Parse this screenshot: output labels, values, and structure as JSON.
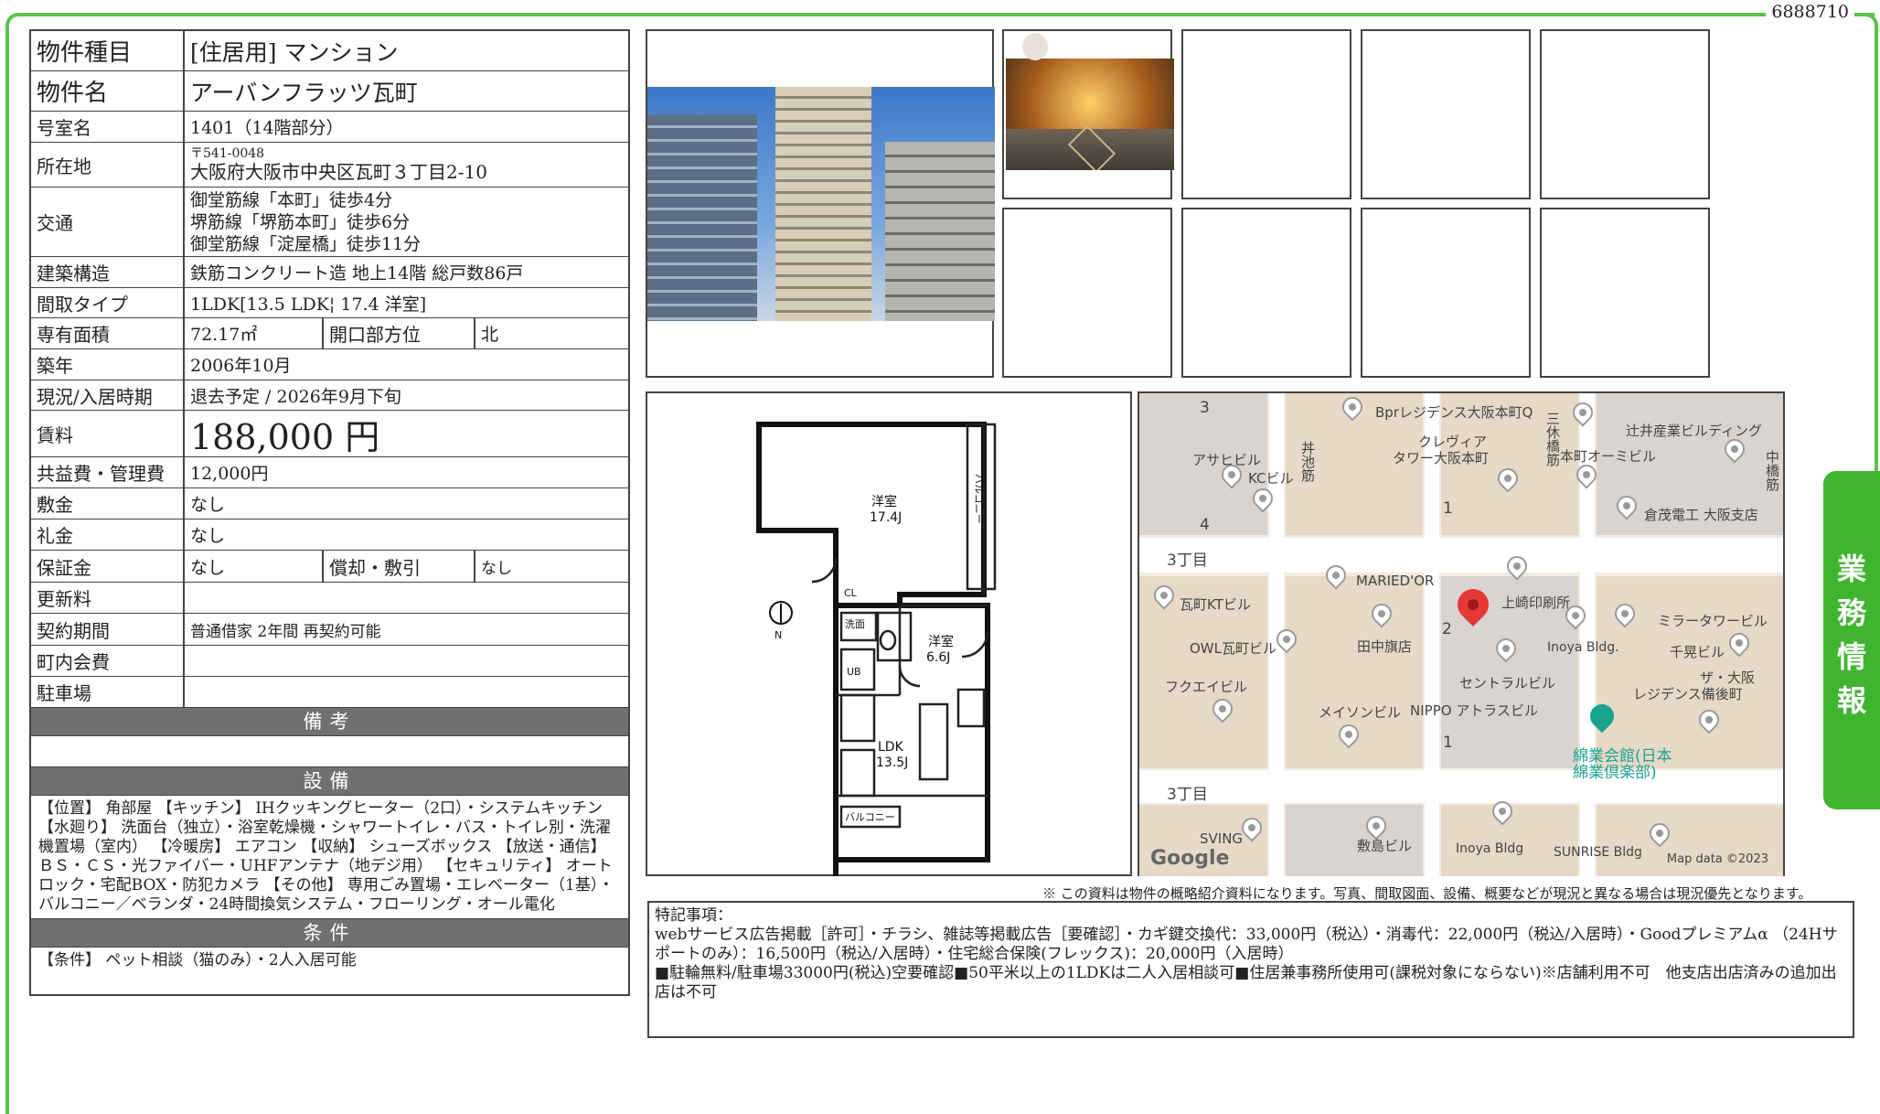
{
  "doc_id": "6888710",
  "spec": {
    "type_label": "物件種目",
    "type_value": "[住居用] マンション",
    "name_label": "物件名",
    "name_value": "アーバンフラッツ瓦町",
    "room_label": "号室名",
    "room_value": "1401（14階部分）",
    "addr_label": "所在地",
    "addr_zip": "〒541-0048",
    "addr_value": "大阪府大阪市中央区瓦町３丁目2-10",
    "access_label": "交通",
    "access_lines": [
      "御堂筋線「本町」徒歩4分",
      "堺筋線「堺筋本町」徒歩6分",
      "御堂筋線「淀屋橋」徒歩11分"
    ],
    "struct_label": "建築構造",
    "struct_value": "鉄筋コンクリート造 地上14階 総戸数86戸",
    "layout_label": "間取タイプ",
    "layout_value": "1LDK[13.5 LDK¦ 17.4 洋室]",
    "area_label": "専有面積",
    "area_value": "72.17㎡",
    "dir_label": "開口部方位",
    "dir_value": "北",
    "built_label": "築年",
    "built_value": "2006年10月",
    "status_label": "現況/入居時期",
    "status_value": "退去予定 / 2026年9月下旬",
    "rent_label": "賃料",
    "rent_value": "188,000 円",
    "fee_label": "共益費・管理費",
    "fee_value": "12,000円",
    "deposit_label": "敷金",
    "deposit_value": "なし",
    "key_label": "礼金",
    "key_value": "なし",
    "guarantee_label": "保証金",
    "guarantee_value": "なし",
    "amort_label": "償却・敷引",
    "amort_value": "なし",
    "renew_label": "更新料",
    "renew_value": "",
    "contract_label": "契約期間",
    "contract_value": "普通借家 2年間 再契約可能",
    "assoc_label": "町内会費",
    "assoc_value": "",
    "parking_label": "駐車場",
    "parking_value": "",
    "remarks_header": "備考",
    "remarks_value": "",
    "equip_header": "設備",
    "equip_text": "【位置】 角部屋 【キッチン】 IHクッキングヒーター（2口）・システムキッチン 【水廻り】 洗面台（独立）・浴室乾燥機・シャワートイレ・バス・トイレ別・洗濯機置場（室内） 【冷暖房】 エアコン 【収納】 シューズボックス 【放送・通信】 ＢＳ・ＣＳ・光ファイバー・UHFアンテナ（地デジ用） 【セキュリティ】 オートロック・宅配BOX・防犯カメラ 【その他】 専用ごみ置場・エレベーター（1基）・バルコニー／ベランダ・24時間換気システム・フローリング・オール電化",
    "cond_header": "条件",
    "cond_text": "【条件】 ペット相談（猫のみ）・2人入居可能"
  },
  "plan": {
    "room1": "洋室",
    "room1_size": "17.4J",
    "room2": "洋室",
    "room2_size": "6.6J",
    "ldk": "LDK",
    "ldk_size": "13.5J",
    "balcony_side": "バルコニー",
    "balcony_bottom": "バルコニー",
    "cl": "CL",
    "wash": "洗面",
    "ub": "UB"
  },
  "map": {
    "labels": [
      "3",
      "Bprレジデンス大阪本町Q",
      "クレヴィア",
      "タワー大阪本町",
      "辻井産業ビルディング",
      "アサヒビル",
      "KCビル",
      "本町オーミビル",
      "倉茂電工 大阪支店",
      "4",
      "3丁目",
      "1",
      "MARIED'OR",
      "上崎印刷所",
      "瓦町KTビル",
      "田中旗店",
      "2",
      "OWL瓦町ビル",
      "ミラータワービル",
      "Inoya Bldg.",
      "千晃ビル",
      "フクエイビル",
      "セントラルビル",
      "ザ・大阪",
      "レジデンス備後町",
      "メイソンビル",
      "NIPPO アトラスビル",
      "綿業会館(日本",
      "綿業倶楽部)",
      "1",
      "3丁目",
      "SVING",
      "敷島ビル",
      "Inoya Bldg",
      "SUNRISE Bldg",
      "丼池筋",
      "三休橋筋",
      "中橋筋"
    ],
    "google": "Google",
    "attribution": "Map data ©2023"
  },
  "note": "※ この資料は物件の概略紹介資料になります。写真、間取図面、設備、概要などが現況と異なる場合は現況優先となります。",
  "remark": {
    "title": "特記事項：",
    "line1": "webサービス広告掲載［許可］・チラシ、雑誌等掲載広告［要確認］・カギ鍵交換代：33,000円（税込）・消毒代：22,000円（税込/入居時）・Goodプレミアムα （24Hサポートのみ）：16,500円（税込/入居時）・住宅総合保険(フレックス)：20,000円（入居時）",
    "line2": "■駐輪無料/駐車場33000円(税込)空要確認■50平米以上の1LDKは二人入居相談可■住居兼事務所使用可(課税対象にならない)※店舗利用不可　他支店出店済みの追加出店は不可"
  },
  "side_tab": [
    "業",
    "務",
    "情",
    "報"
  ]
}
